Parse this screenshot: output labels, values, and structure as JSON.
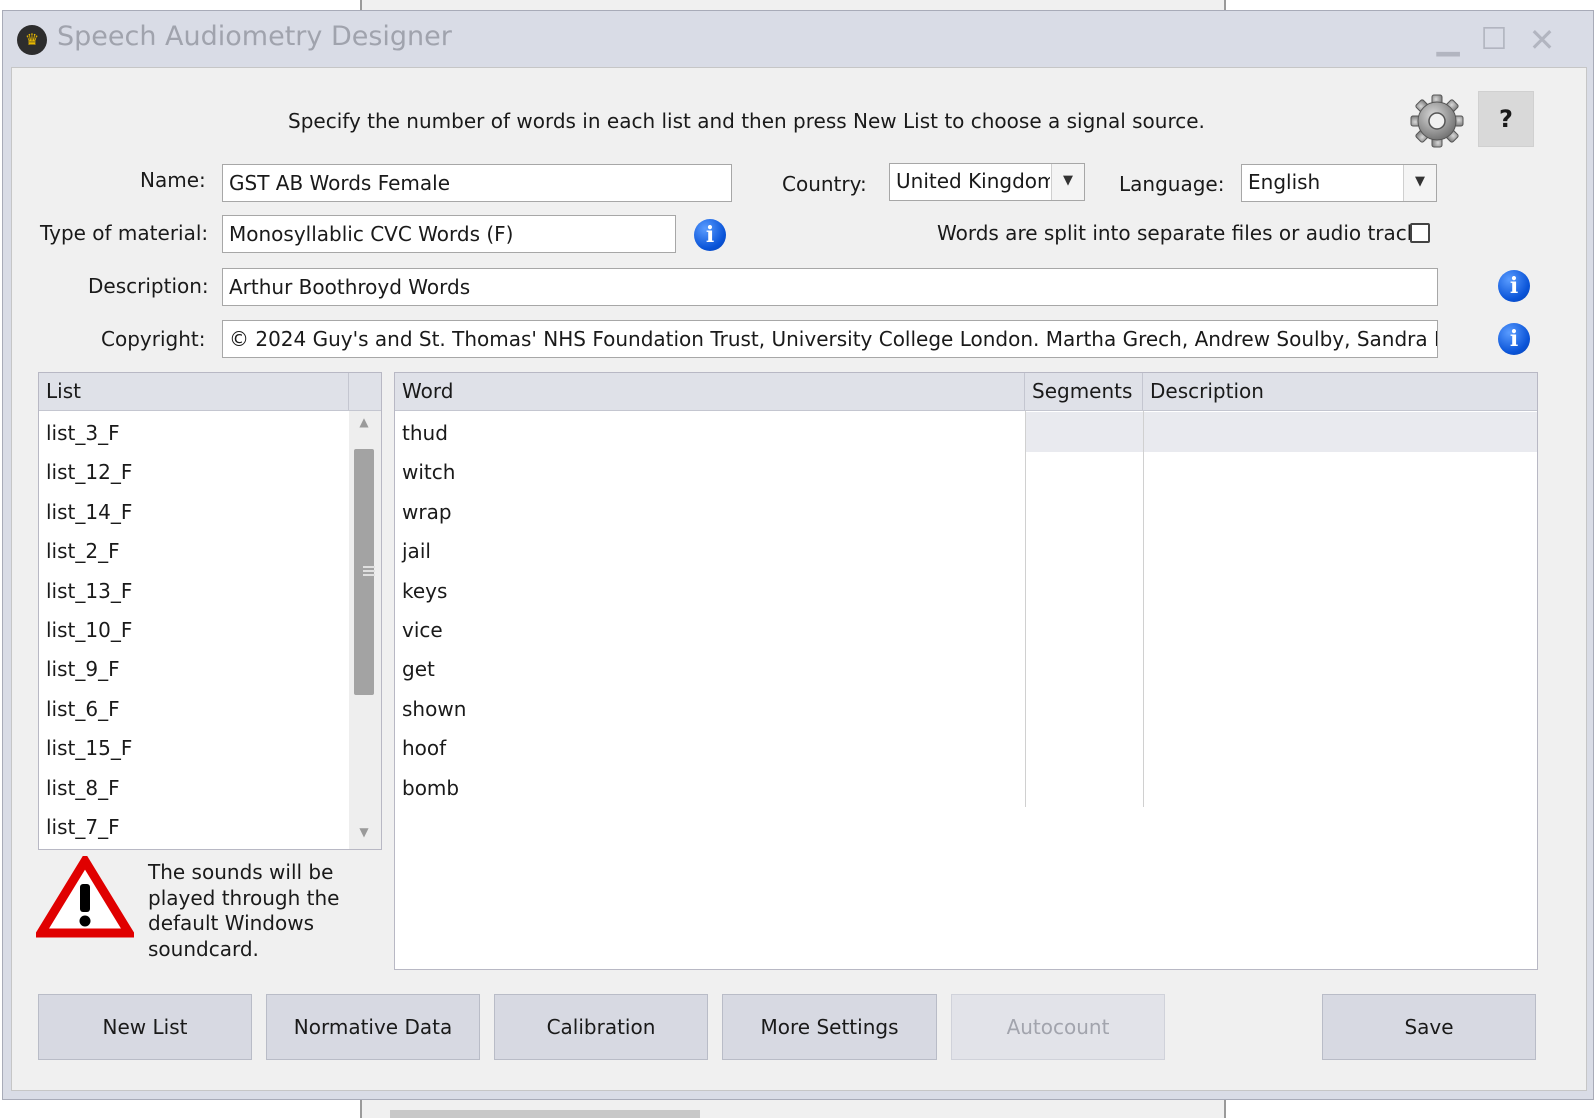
{
  "window": {
    "title": "Speech Audiometry Designer"
  },
  "instruction": "Specify the number of words in each list and then press New List to choose a signal source.",
  "form": {
    "name_label": "Name:",
    "name_value": "GST AB Words Female",
    "country_label": "Country:",
    "country_value": "United Kingdom",
    "language_label": "Language:",
    "language_value": "English",
    "material_label": "Type of material:",
    "material_value": "Monosyllablic CVC Words (F)",
    "split_label": "Words are split into separate files or audio tracks",
    "split_checked": false,
    "description_label": "Description:",
    "description_value": "Arthur Boothroyd Words",
    "copyright_label": "Copyright:",
    "copyright_value": "© 2024 Guy's and St. Thomas' NHS Foundation Trust, University College London. Martha Grech, Andrew Soulby, Sandra Driver"
  },
  "list_grid": {
    "header": "List",
    "items": [
      "list_3_F",
      "list_12_F",
      "list_14_F",
      "list_2_F",
      "list_13_F",
      "list_10_F",
      "list_9_F",
      "list_6_F",
      "list_15_F",
      "list_8_F",
      "list_7_F"
    ]
  },
  "word_grid": {
    "headers": {
      "word": "Word",
      "segments": "Segments",
      "description": "Description"
    },
    "words": [
      "thud",
      "witch",
      "wrap",
      "jail",
      "keys",
      "vice",
      "get",
      "shown",
      "hoof",
      "bomb"
    ]
  },
  "warning": {
    "icon": "warning-triangle-icon",
    "text": "The sounds will be played through the default Windows soundcard."
  },
  "buttons": {
    "new_list": "New List",
    "normative_data": "Normative Data",
    "calibration": "Calibration",
    "more_settings": "More Settings",
    "autocount": "Autocount",
    "save": "Save",
    "help": "?"
  },
  "icons": {
    "settings": "gear-icon",
    "info": "info-icon"
  },
  "colors": {
    "info_blue": "#0a54d8",
    "warning_red": "#e00000",
    "header_bg": "#dfe1e8"
  }
}
